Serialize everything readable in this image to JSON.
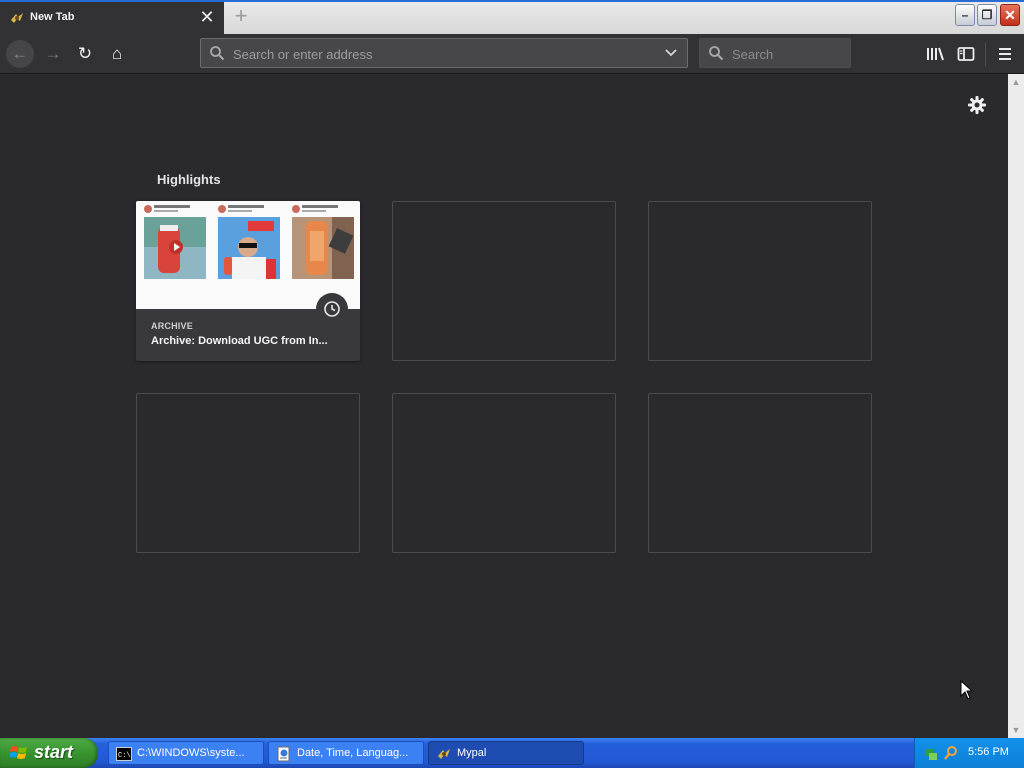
{
  "tab": {
    "title": "New Tab",
    "close_glyph": "✕"
  },
  "newtab_glyph": "+",
  "window": {
    "min": "–",
    "max": "❐",
    "close": "✕"
  },
  "toolbar": {
    "back": "←",
    "forward": "→",
    "reload": "↻",
    "home": "⌂",
    "url_placeholder": "Search or enter address",
    "search_placeholder": "Search"
  },
  "highlights": {
    "title": "Highlights",
    "cards": [
      {
        "meta": "ARCHIVE",
        "title": "Archive: Download UGC from In..."
      }
    ]
  },
  "taskbar": {
    "start_label": "start",
    "tasks": [
      {
        "label": "C:\\WINDOWS\\syste..."
      },
      {
        "label": "Date, Time, Languag..."
      },
      {
        "label": "Mypal"
      }
    ],
    "clock": "5:56 PM"
  },
  "icons": [
    "back-icon",
    "forward-icon",
    "reload-icon",
    "home-icon",
    "search-icon",
    "dropdown-chevron-icon",
    "library-icon",
    "sidebar-icon",
    "menu-icon",
    "gear-icon",
    "clock-icon",
    "windows-logo-icon"
  ],
  "colors": {
    "background": "#2a2a2e",
    "toolbar": "#323234",
    "taskbar": "#245edb",
    "start": "#37942e"
  }
}
